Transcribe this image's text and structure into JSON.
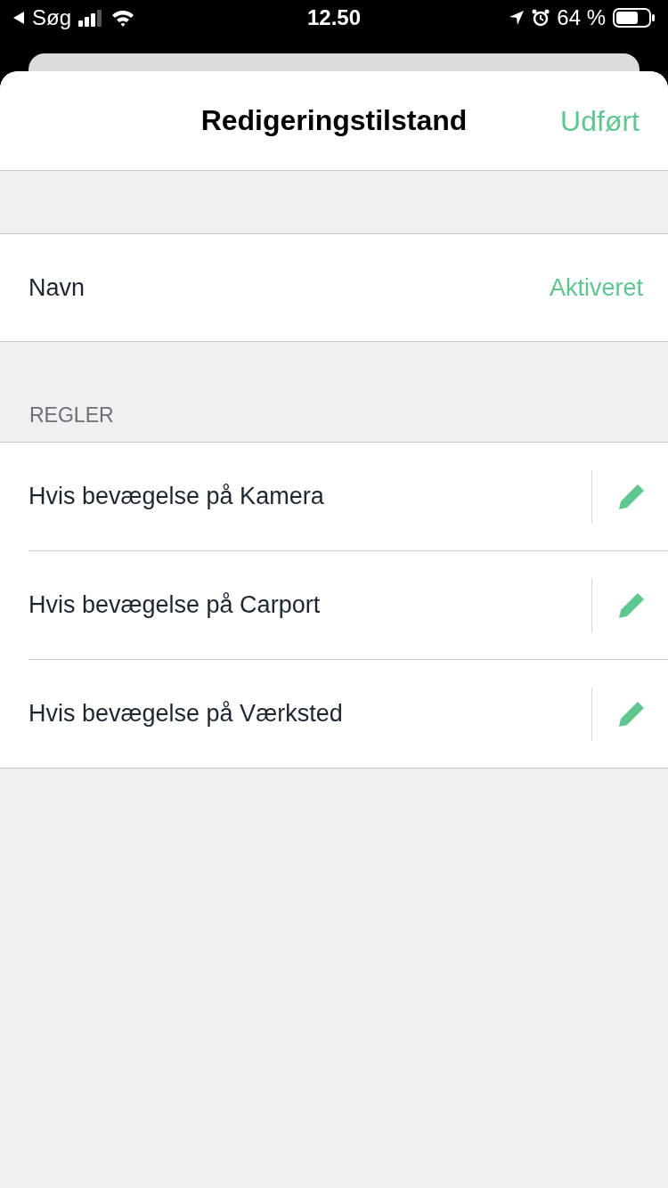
{
  "status_bar": {
    "back_label": "Søg",
    "time": "12.50",
    "battery": "64 %"
  },
  "header": {
    "title": "Redigeringstilstand",
    "done": "Udført"
  },
  "name_row": {
    "label": "Navn",
    "value": "Aktiveret"
  },
  "rules_section": {
    "header": "REGLER",
    "rules": [
      {
        "label": "Hvis bevægelse på Kamera"
      },
      {
        "label": "Hvis bevægelse på Carport"
      },
      {
        "label": "Hvis bevægelse på Værksted"
      }
    ]
  }
}
